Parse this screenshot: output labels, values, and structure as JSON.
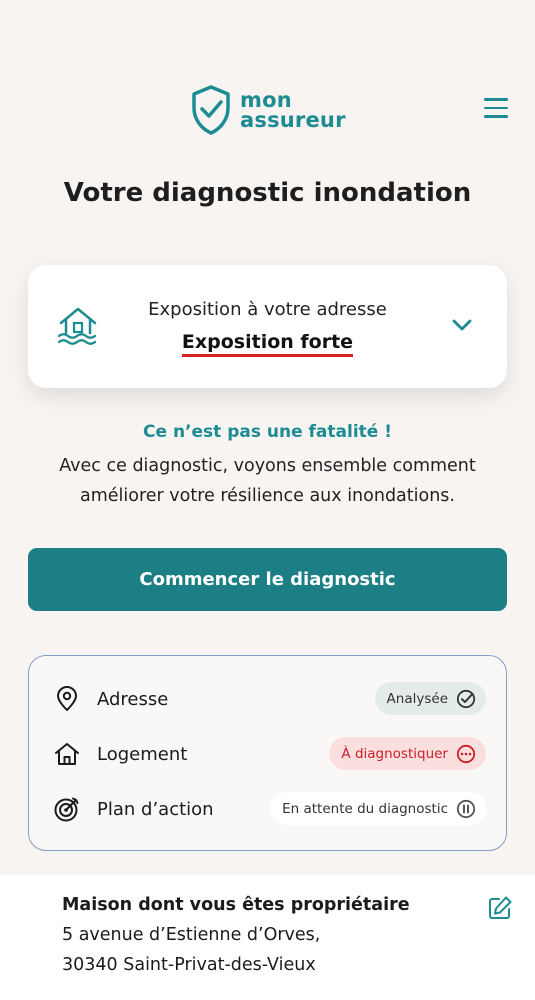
{
  "header": {
    "brand_line1": "mon",
    "brand_line2": "assureur",
    "menu_icon": "hamburger-menu-icon",
    "brand_color": "#1c8c92"
  },
  "page_title": "Votre diagnostic inondation",
  "exposure": {
    "icon": "house-flood-icon",
    "label": "Exposition à votre adresse",
    "value": "Exposition forte",
    "expand_icon": "chevron-down-icon",
    "alert_color": "#d61f1f"
  },
  "message": {
    "headline": "Ce n’est pas une fatalité !",
    "line1": "Avec ce diagnostic, voyons ensemble comment",
    "line2": "améliorer votre résilience aux inondations."
  },
  "cta": {
    "label": "Commencer le diagnostic",
    "color": "#1c7f86"
  },
  "steps": [
    {
      "label": "Adresse",
      "icon": "location-pin-icon",
      "status": "Analysée",
      "status_icon": "check-circle-icon"
    },
    {
      "label": "Logement",
      "icon": "home-icon",
      "status": "À diagnostiquer",
      "status_icon": "more-circle-icon"
    },
    {
      "label": "Plan d’action",
      "icon": "target-icon",
      "status": "En attente du diagnostic",
      "status_icon": "pause-circle-icon"
    }
  ],
  "property": {
    "title": "Maison dont vous êtes propriétaire",
    "address_line1": "5 avenue d’Estienne d’Orves,",
    "address_line2": "30340 Saint-Privat-des-Vieux",
    "edit_icon": "edit-icon"
  }
}
